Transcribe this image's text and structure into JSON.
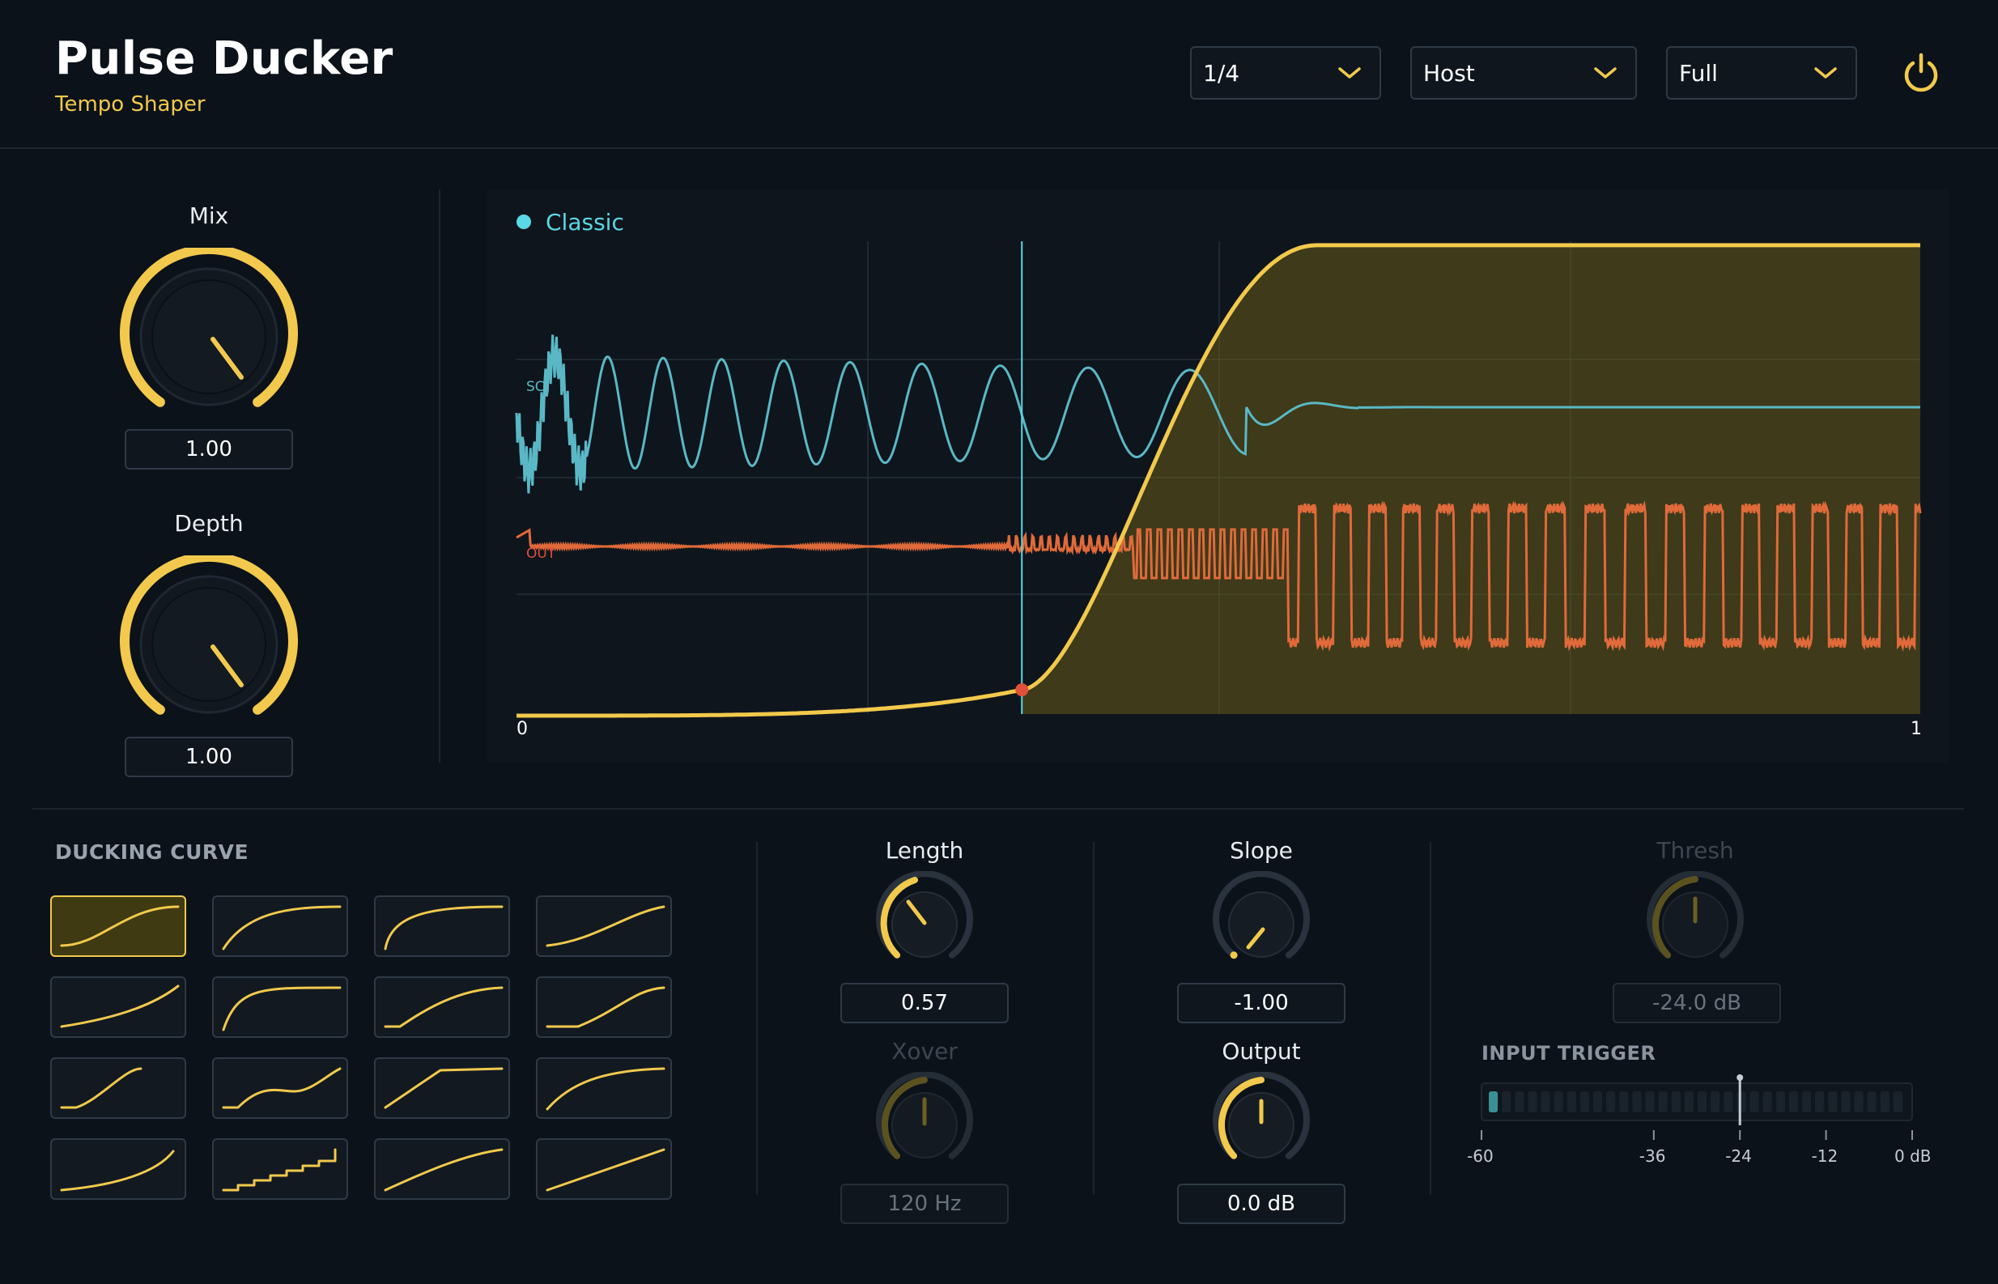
{
  "header": {
    "title": "Pulse Ducker",
    "subtitle": "Tempo Shaper",
    "rate_value": "1/4",
    "sync_value": "Host",
    "mode_value": "Full"
  },
  "colors": {
    "accent": "#f2c94c",
    "sidechain": "#5ab8c6",
    "output": "#e06a3a",
    "background": "#0c121a"
  },
  "knobs": {
    "mix": {
      "label": "Mix",
      "value": "1.00"
    },
    "depth": {
      "label": "Depth",
      "value": "1.00"
    },
    "length": {
      "label": "Length",
      "value": "0.57"
    },
    "slope": {
      "label": "Slope",
      "value": "-1.00"
    },
    "thresh": {
      "label": "Thresh",
      "value": "-24.0 dB"
    },
    "xover": {
      "label": "Xover",
      "value": "120 Hz"
    },
    "output": {
      "label": "Output",
      "value": "0.0 dB"
    }
  },
  "graph": {
    "legend": "Classic",
    "sc_label": "SC",
    "out_label": "OUT",
    "x_start": "0",
    "x_end": "1",
    "playhead_position": 0.36
  },
  "ducking_curve": {
    "title": "DUCKING CURVE",
    "selected_index": 0,
    "presets": 16
  },
  "input_trigger": {
    "title": "INPUT TRIGGER",
    "ticks": [
      "-60",
      "-36",
      "-24",
      "-12",
      "0 dB"
    ],
    "threshold_db": -24,
    "level_db": -60
  },
  "icons": {
    "power": "power-icon",
    "dropdown": "chevron-down-icon"
  }
}
